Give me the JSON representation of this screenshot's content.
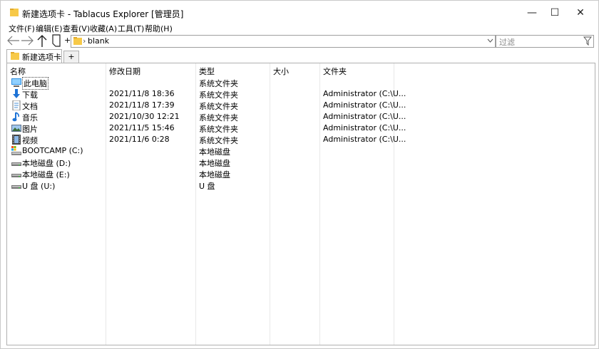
{
  "window": {
    "title": "新建选项卡 - Tablacus Explorer [管理员]",
    "minimize": "—",
    "maximize": "☐",
    "close": "✕"
  },
  "menu": [
    {
      "label": "文件(F)"
    },
    {
      "label": "编辑(E)"
    },
    {
      "label": "查看(V)"
    },
    {
      "label": "收藏(A)"
    },
    {
      "label": "工具(T)"
    },
    {
      "label": "帮助(H)"
    }
  ],
  "nav": {
    "address": "blank",
    "address_separator": "›",
    "filter_placeholder": "过滤",
    "plus": "+"
  },
  "tabs": {
    "active_label": "新建选项卡",
    "add_label": "+"
  },
  "columns": [
    "名称",
    "修改日期",
    "类型",
    "大小",
    "文件夹"
  ],
  "rows": [
    {
      "icon": "computer-icon",
      "name": "此电脑",
      "date": "",
      "type": "系统文件夹",
      "size": "",
      "folder": ""
    },
    {
      "icon": "download-icon",
      "name": "下载",
      "date": "2021/11/8 18:36",
      "type": "系统文件夹",
      "size": "",
      "folder": "Administrator (C:\\U..."
    },
    {
      "icon": "document-icon",
      "name": "文档",
      "date": "2021/11/8 17:39",
      "type": "系统文件夹",
      "size": "",
      "folder": "Administrator (C:\\U..."
    },
    {
      "icon": "music-icon",
      "name": "音乐",
      "date": "2021/10/30 12:21",
      "type": "系统文件夹",
      "size": "",
      "folder": "Administrator (C:\\U..."
    },
    {
      "icon": "picture-icon",
      "name": "图片",
      "date": "2021/11/5 15:46",
      "type": "系统文件夹",
      "size": "",
      "folder": "Administrator (C:\\U..."
    },
    {
      "icon": "video-icon",
      "name": "视频",
      "date": "2021/11/6 0:28",
      "type": "系统文件夹",
      "size": "",
      "folder": "Administrator (C:\\U..."
    },
    {
      "icon": "system-drive-icon",
      "name": "BOOTCAMP (C:)",
      "date": "",
      "type": "本地磁盘",
      "size": "",
      "folder": ""
    },
    {
      "icon": "drive-icon",
      "name": "本地磁盘 (D:)",
      "date": "",
      "type": "本地磁盘",
      "size": "",
      "folder": ""
    },
    {
      "icon": "drive-icon",
      "name": "本地磁盘 (E:)",
      "date": "",
      "type": "本地磁盘",
      "size": "",
      "folder": ""
    },
    {
      "icon": "drive-icon",
      "name": "U 盘 (U:)",
      "date": "",
      "type": "U 盘",
      "size": "",
      "folder": ""
    }
  ],
  "colors": {
    "folder_yellow": "#f7c948",
    "accent_blue": "#1e73d6",
    "border_gray": "#b0b0b0"
  }
}
